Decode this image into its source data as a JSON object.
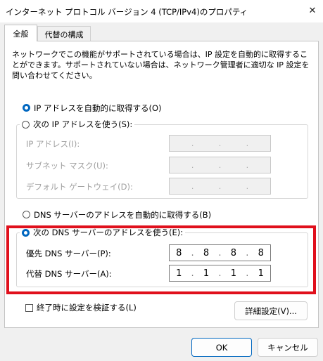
{
  "window": {
    "title": "インターネット プロトコル バージョン 4 (TCP/IPv4)のプロパティ",
    "close_glyph": "✕"
  },
  "tabs": [
    {
      "label": "全般"
    },
    {
      "label": "代替の構成"
    }
  ],
  "description": "ネットワークでこの機能がサポートされている場合は、IP 設定を自動的に取得することができます。サポートされていない場合は、ネットワーク管理者に適切な IP 設定を問い合わせてください。",
  "ip": {
    "auto_label": "IP アドレスを自動的に取得する(O)",
    "auto_selected": true,
    "manual_label": "次の IP アドレスを使う(S):",
    "fields": [
      {
        "label": "IP アドレス(I):"
      },
      {
        "label": "サブネット マスク(U):"
      },
      {
        "label": "デフォルト ゲートウェイ(D):"
      }
    ]
  },
  "dns": {
    "auto_label": "DNS サーバーのアドレスを自動的に取得する(B)",
    "manual_label": "次の DNS サーバーのアドレスを使う(E):",
    "manual_selected": true,
    "preferred": {
      "label": "優先 DNS サーバー(P):",
      "octets": [
        "8",
        "8",
        "8",
        "8"
      ]
    },
    "alternate": {
      "label": "代替 DNS サーバー(A):",
      "octets": [
        "1",
        "1",
        "1",
        "1"
      ]
    }
  },
  "validate_label": "終了時に設定を検証する(L)",
  "advanced_button": "詳細設定(V)...",
  "ok_button": "OK",
  "cancel_button": "キャンセル",
  "dot": ".",
  "colors": {
    "accent": "#0067c0",
    "highlight": "#e0101c"
  }
}
